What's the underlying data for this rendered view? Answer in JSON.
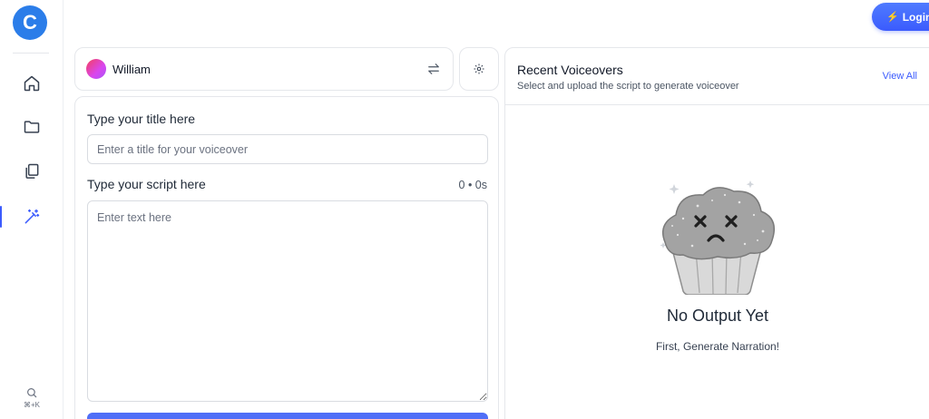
{
  "app": {
    "logo_letter": "C"
  },
  "header": {
    "login_label": "Login"
  },
  "sidebar": {
    "items": [
      {
        "name": "home"
      },
      {
        "name": "folder"
      },
      {
        "name": "copy"
      },
      {
        "name": "magic-wand",
        "active": true
      }
    ],
    "search_shortcut": "⌘+K"
  },
  "voice": {
    "name": "William"
  },
  "form": {
    "title_label": "Type your title here",
    "title_placeholder": "Enter a title for your voiceover",
    "script_label": "Type your script here",
    "counter": "0 • 0s",
    "script_placeholder": "Enter text here"
  },
  "recent": {
    "title": "Recent Voiceovers",
    "subtitle": "Select and upload the script to generate voiceover",
    "view_all": "View All",
    "empty_title": "No Output Yet",
    "empty_subtitle": "First, Generate Narration!"
  },
  "colors": {
    "accent": "#3b5bfd",
    "logo": "#2b7de9",
    "generate_button": "#4f6ef7"
  }
}
